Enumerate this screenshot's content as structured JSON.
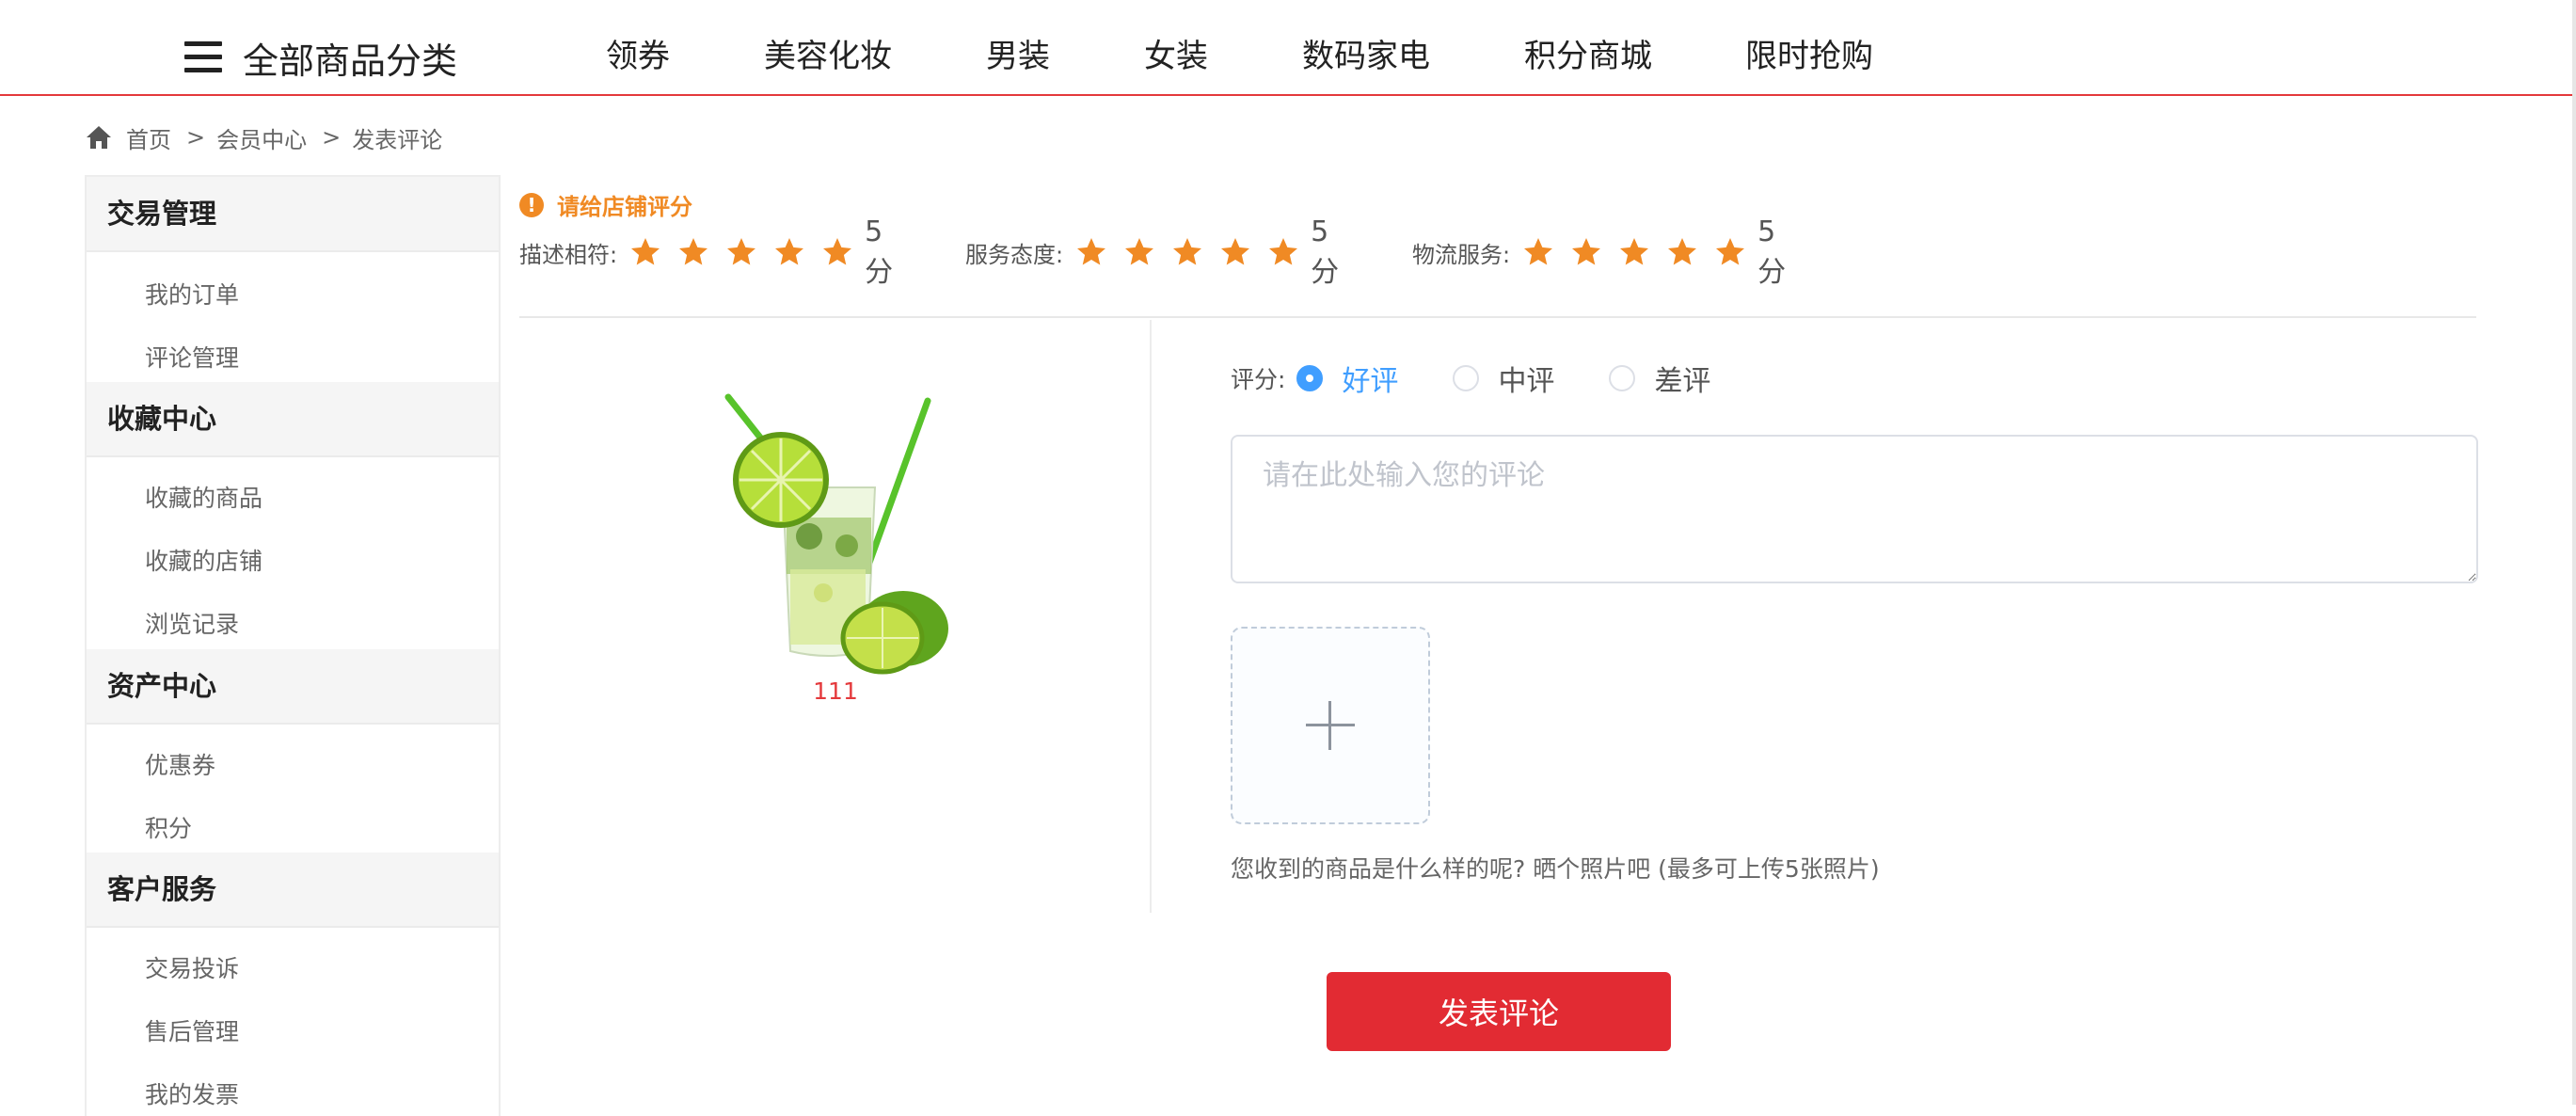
{
  "nav": {
    "all_categories": "全部商品分类",
    "links": [
      "领券",
      "美容化妆",
      "男装",
      "女装",
      "数码家电",
      "积分商城",
      "限时抢购"
    ]
  },
  "breadcrumb": {
    "home": "首页",
    "sep1": ">",
    "member": "会员中心",
    "sep2": ">",
    "current": "发表评论"
  },
  "sidebar": {
    "groups": [
      {
        "title": "交易管理",
        "items": [
          "我的订单",
          "评论管理"
        ]
      },
      {
        "title": "收藏中心",
        "items": [
          "收藏的商品",
          "收藏的店铺",
          "浏览记录"
        ]
      },
      {
        "title": "资产中心",
        "items": [
          "优惠券",
          "积分"
        ]
      },
      {
        "title": "客户服务",
        "items": [
          "交易投诉",
          "售后管理",
          "我的发票"
        ]
      }
    ]
  },
  "shop_rating": {
    "notice": "请给店铺评分",
    "items": [
      {
        "label": "描述相符:",
        "stars": 5,
        "score": "5分"
      },
      {
        "label": "服务态度:",
        "stars": 5,
        "score": "5分"
      },
      {
        "label": "物流服务:",
        "stars": 5,
        "score": "5分"
      }
    ],
    "star_color": "#f08a24"
  },
  "product": {
    "name": "111",
    "image_icon": "mojito-drink-image"
  },
  "review": {
    "score_label": "评分:",
    "options": [
      "好评",
      "中评",
      "差评"
    ],
    "selected": "好评",
    "comment_placeholder": "请在此处输入您的评论",
    "comment_value": "",
    "upload_hint": "您收到的商品是什么样的呢? 晒个照片吧 (最多可上传5张照片)",
    "submit_label": "发表评论"
  },
  "colors": {
    "accent_red": "#e22b33",
    "link_blue": "#409eff",
    "warn_orange": "#f08a24"
  }
}
